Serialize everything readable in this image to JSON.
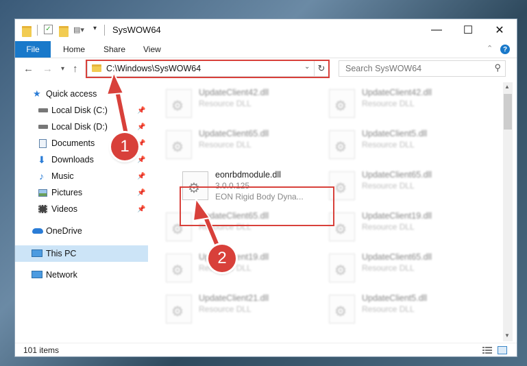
{
  "window": {
    "title": "SysWOW64",
    "controls": {
      "minimize": "—",
      "maximize": "☐",
      "close": "✕"
    }
  },
  "ribbon": {
    "tabs": [
      "File",
      "Home",
      "Share",
      "View"
    ],
    "help": "?"
  },
  "nav": {
    "address": "C:\\Windows\\SysWOW64",
    "search_placeholder": "Search SysWOW64"
  },
  "sidebar": {
    "items": [
      {
        "label": "Quick access",
        "icon": "star-icon",
        "pinned": false
      },
      {
        "label": "Local Disk (C:)",
        "icon": "drive-icon",
        "pinned": true
      },
      {
        "label": "Local Disk (D:)",
        "icon": "drive-icon",
        "pinned": true
      },
      {
        "label": "Documents",
        "icon": "documents-icon",
        "pinned": true
      },
      {
        "label": "Downloads",
        "icon": "downloads-icon",
        "pinned": true
      },
      {
        "label": "Music",
        "icon": "music-icon",
        "pinned": true
      },
      {
        "label": "Pictures",
        "icon": "pictures-icon",
        "pinned": true
      },
      {
        "label": "Videos",
        "icon": "videos-icon",
        "pinned": true
      },
      {
        "label": "OneDrive",
        "icon": "onedrive-icon"
      },
      {
        "label": "This PC",
        "icon": "computer-icon",
        "selected": true
      },
      {
        "label": "Network",
        "icon": "network-icon"
      }
    ]
  },
  "files": [
    {
      "name": "UpdateClient42.dll",
      "type": "Resource DLL"
    },
    {
      "name": "UpdateClient42.dll",
      "type": "Resource DLL"
    },
    {
      "name": "UpdateClient65.dll",
      "type": "Resource DLL"
    },
    {
      "name": "UpdateClient5.dll",
      "type": "Resource DLL"
    },
    {
      "name": "eonrbdmodule.dll",
      "version": "3.0.0.125",
      "description": "EON Rigid Body Dyna..."
    },
    {
      "name": "UpdateClient65.dll",
      "type": "Resource DLL"
    },
    {
      "name": "UpdateClient65.dll",
      "type": "Resource DLL"
    },
    {
      "name": "UpdateClient19.dll",
      "type": "Resource DLL"
    },
    {
      "name": "UpdateClient19.dll",
      "type": "Resource DLL"
    },
    {
      "name": "UpdateClient65.dll",
      "type": "Resource DLL"
    },
    {
      "name": "UpdateClient21.dll",
      "type": "Resource DLL"
    },
    {
      "name": "UpdateClient5.dll",
      "type": "Resource DLL"
    }
  ],
  "status": {
    "count": "101 items"
  },
  "annotations": {
    "step1": "1",
    "step2": "2",
    "color": "#d8403a"
  }
}
